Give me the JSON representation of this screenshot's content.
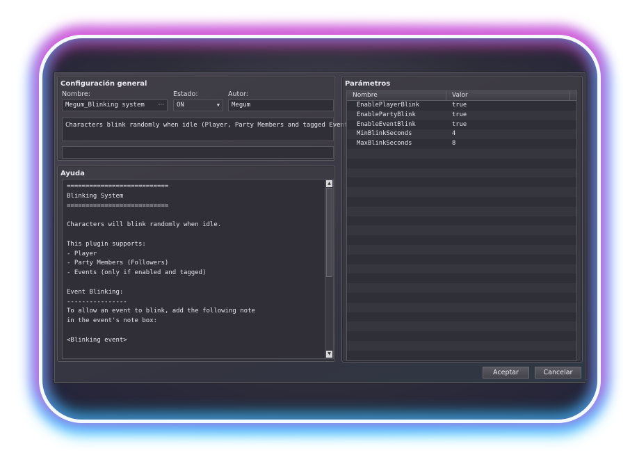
{
  "general": {
    "title": "Configuración general",
    "name_label": "Nombre:",
    "name_value": "Megum_Blinking system",
    "name_button": "···",
    "status_label": "Estado:",
    "status_value": "ON",
    "author_label": "Autor:",
    "author_value": "Megum",
    "description": "Characters blink randomly when idle (Player, Party Members and tagged Events).",
    "extra_field": ""
  },
  "help": {
    "title": "Ayuda",
    "text": "===========================\nBlinking System\n===========================\n\nCharacters will blink randomly when idle.\n\nThis plugin supports:\n- Player\n- Party Members (Followers)\n- Events (only if enabled and tagged)\n\nEvent Blinking:\n----------------\nTo allow an event to blink, add the following note\nin the event's note box:\n\n<Blinking event>\n\n- - - - -"
  },
  "params": {
    "title": "Parámetros",
    "col_name": "Nombre",
    "col_value": "Valor",
    "rows": [
      {
        "name": "EnablePlayerBlink",
        "value": "true"
      },
      {
        "name": "EnablePartyBlink",
        "value": "true"
      },
      {
        "name": "EnableEventBlink",
        "value": "true"
      },
      {
        "name": "MinBlinkSeconds",
        "value": "4"
      },
      {
        "name": "MaxBlinkSeconds",
        "value": "8"
      }
    ]
  },
  "buttons": {
    "ok": "Aceptar",
    "cancel": "Cancelar"
  },
  "colors": {
    "neon_top": "#ff3cc8",
    "neon_bottom": "#1ec8ff",
    "dialog_bg": "#3c3a45"
  },
  "icons": {
    "scroll_up": "scroll-up-arrow-icon",
    "scroll_down": "scroll-down-arrow-icon",
    "dropdown": "dropdown-arrow-icon"
  }
}
